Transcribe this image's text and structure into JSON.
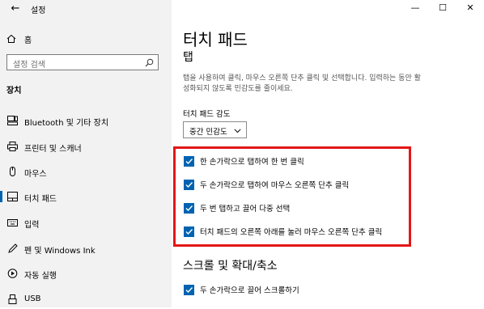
{
  "window": {
    "title": "설정",
    "controls": {
      "minimize": "—",
      "maximize": "☐",
      "close": "✕"
    }
  },
  "sidebar": {
    "back": "←",
    "home_label": "홈",
    "search_placeholder": "설정 검색",
    "section_heading": "장치",
    "items": [
      {
        "label": "Bluetooth 및 기타 장치",
        "icon": "bluetooth-devices-icon"
      },
      {
        "label": "프린터 및 스캐너",
        "icon": "printer-icon"
      },
      {
        "label": "마우스",
        "icon": "mouse-icon"
      },
      {
        "label": "터치 패드",
        "icon": "touchpad-icon",
        "selected": true
      },
      {
        "label": "입력",
        "icon": "keyboard-icon"
      },
      {
        "label": "펜 및 Windows Ink",
        "icon": "pen-icon"
      },
      {
        "label": "자동 실행",
        "icon": "autoplay-icon"
      },
      {
        "label": "USB",
        "icon": "usb-icon"
      }
    ]
  },
  "main": {
    "title": "터치 패드",
    "tap_heading": "탭",
    "description": "탭을 사용하여 클릭, 마우스 오른쪽 단추 클릭 및 선택합니다. 입력하는 동안 활성화되지 않도록 민감도를 줄이세요.",
    "sensitivity_label": "터치 패드 감도",
    "sensitivity_value": "중간 민감도",
    "options": [
      {
        "label": "한 손가락으로 탭하여 한 번 클릭",
        "checked": true
      },
      {
        "label": "두 손가락으로 탭하여 마우스 오른쪽 단추 클릭",
        "checked": true
      },
      {
        "label": "두 번 탭하고 끌어 다중 선택",
        "checked": true
      },
      {
        "label": "터치 패드의 오른쪽 아래를 눌러 마우스 오른쪽 단추 클릭",
        "checked": true
      }
    ],
    "scroll_heading": "스크롤 및 확대/축소",
    "scroll_options": [
      {
        "label": "두 손가락으로 끌어 스크롤하기",
        "checked": true
      }
    ]
  },
  "colors": {
    "accent": "#0063b1",
    "highlight": "#e31717",
    "sidebar_bg": "#f2f2f2"
  }
}
